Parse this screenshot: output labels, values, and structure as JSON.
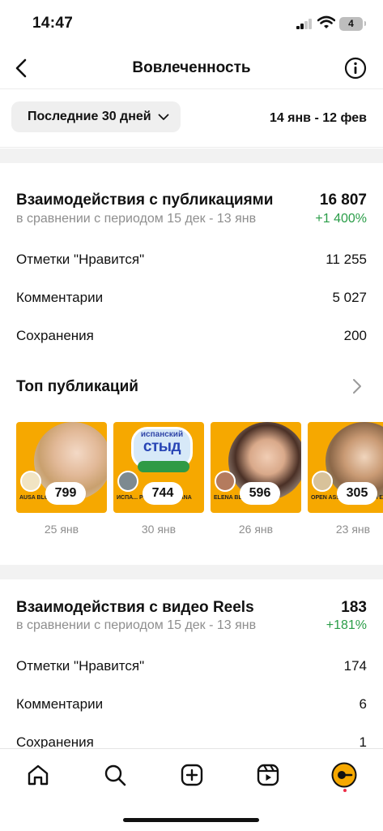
{
  "status_bar": {
    "time": "14:47",
    "battery": "4"
  },
  "header": {
    "title": "Вовлеченность",
    "back_icon": "chevron-left-icon",
    "info_icon": "info-icon"
  },
  "filter": {
    "period_label": "Последние 30 дней",
    "date_range": "14 янв - 12 фев"
  },
  "posts_section": {
    "title": "Взаимодействия с публикациями",
    "total": "16 807",
    "compare": "в сравнении с периодом 15 дек - 13 янв",
    "change": "+1 400%",
    "metrics": [
      {
        "label": "Отметки \"Нравится\"",
        "value": "11 255"
      },
      {
        "label": "Комментарии",
        "value": "5 027"
      },
      {
        "label": "Сохранения",
        "value": "200"
      }
    ]
  },
  "top_posts": {
    "title": "Топ публикаций",
    "items": [
      {
        "count": "799",
        "date": "25 янв",
        "caption": "AUSA BLOGGER"
      },
      {
        "count": "744",
        "date": "30 янв",
        "caption": "ИСПА... PODCAST ESPAÑA",
        "sticker_top": "испанский",
        "sticker_main": "стыд"
      },
      {
        "count": "596",
        "date": "26 янв",
        "caption": "ELENA BLOGGER"
      },
      {
        "count": "305",
        "date": "23 янв",
        "caption": "OPEN ASSOCIA... RUS A ESPAÑA"
      }
    ]
  },
  "reels_section": {
    "title": "Взаимодействия с видео Reels",
    "total": "183",
    "compare": "в сравнении с периодом 15 дек - 13 янв",
    "change": "+181%",
    "metrics": [
      {
        "label": "Отметки \"Нравится\"",
        "value": "174"
      },
      {
        "label": "Комментарии",
        "value": "6"
      },
      {
        "label": "Сохранения",
        "value": "1"
      }
    ]
  },
  "bottom_nav": {
    "items": [
      "home-icon",
      "search-icon",
      "create-icon",
      "reels-icon",
      "profile-icon"
    ]
  },
  "colors": {
    "accent_green": "#2a9d48",
    "thumb_orange": "#f6a800",
    "muted": "#8e8e8e"
  }
}
